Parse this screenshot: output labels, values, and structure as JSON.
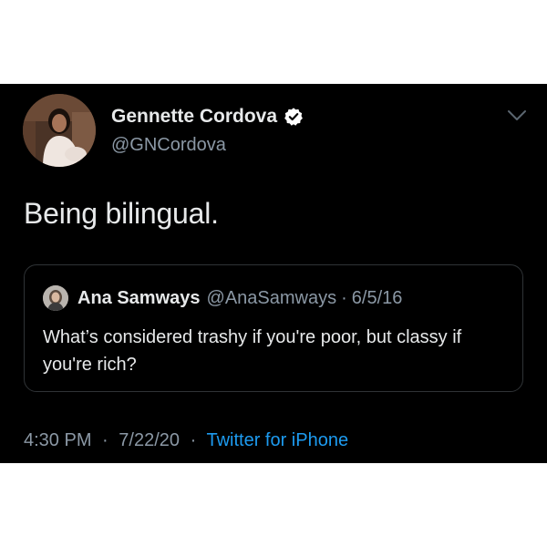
{
  "tweet": {
    "author": {
      "display_name": "Gennette Cordova",
      "handle": "@GNCordova",
      "verified": true
    },
    "text": "Being bilingual.",
    "quoted_tweet": {
      "author_name": "Ana Samways",
      "author_handle": "@AnaSamways",
      "separator": "·",
      "date": "6/5/16",
      "text": "What’s considered trashy if you're poor, but classy if you're rich?"
    },
    "time": "4:30 PM",
    "separator": "·",
    "date": "7/22/20",
    "source": "Twitter for iPhone"
  },
  "icons": {
    "verified": "verified-badge-icon",
    "menu": "chevron-down-icon"
  },
  "colors": {
    "background": "#000000",
    "text": "#e7e9ea",
    "secondary": "#8b98a5",
    "link": "#1d9bf0",
    "border": "#2f3336"
  }
}
